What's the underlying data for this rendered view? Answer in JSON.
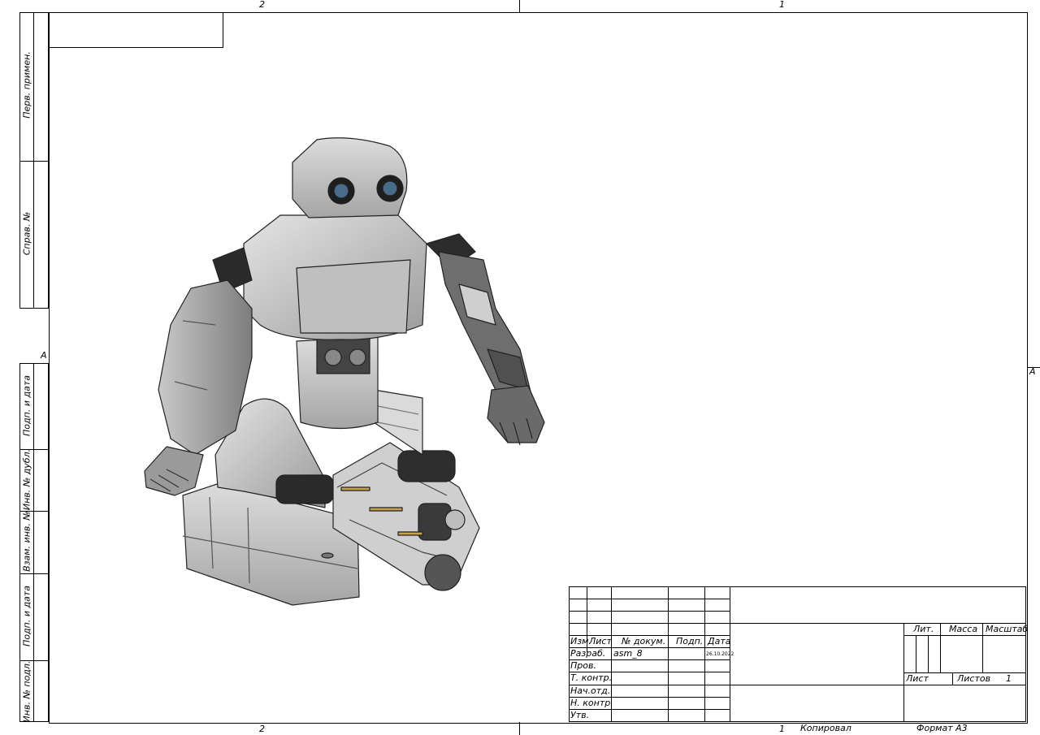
{
  "zones": {
    "top_left": "2",
    "top_right": "1",
    "bottom_left": "2",
    "bottom_right": "1",
    "side_left": "A",
    "side_right": "A"
  },
  "left_strip": {
    "perv_primen": "Перв. примен.",
    "sprav_no": "Справ. №",
    "podp_data_1": "Подп. и дата",
    "inv_dubl": "Инв. № дубл.",
    "vzam_inv": "Взам. инв. №",
    "podp_data_2": "Подп. и дата",
    "inv_podl": "Инв. № подл."
  },
  "title_block": {
    "headers": {
      "izm": "Изм.",
      "list": "Лист",
      "doc_no": "№ докум.",
      "podp": "Подп.",
      "data": "Дата"
    },
    "rows": {
      "razrab": "Разраб.",
      "prov": "Пров.",
      "t_kontr": "Т. контр.",
      "nach_otd": "Нач.отд.",
      "n_kontr": "Н. контр.",
      "utv": "Утв."
    },
    "razrab_doc": "asm_8",
    "razrab_date": "26.10.2022",
    "lit": "Лит.",
    "massa": "Масса",
    "masshtab": "Масштаб",
    "list_label": "Лист",
    "listov_label": "Листов",
    "listov_value": "1"
  },
  "footer": {
    "kopiroval": "Копировал",
    "format": "Формат А3"
  },
  "drawing": {
    "subject": "robot-assembly-isometric"
  }
}
